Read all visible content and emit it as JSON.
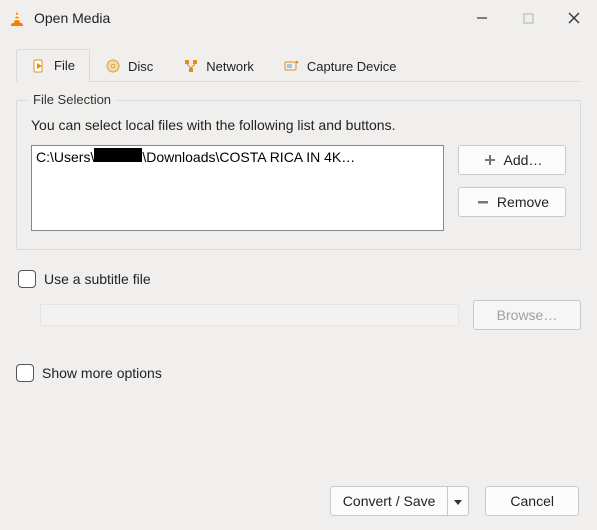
{
  "window": {
    "title": "Open Media"
  },
  "tabs": {
    "file": "File",
    "disc": "Disc",
    "network": "Network",
    "capture": "Capture Device"
  },
  "file_selection": {
    "group_title": "File Selection",
    "hint": "You can select local files with the following list and buttons.",
    "entry_prefix": "C:\\Users\\",
    "entry_suffix": "\\Downloads\\COSTA RICA IN 4K…",
    "add_label": "Add…",
    "remove_label": "Remove"
  },
  "subtitle": {
    "checkbox_label": "Use a subtitle file",
    "browse_label": "Browse…"
  },
  "more_options_label": "Show more options",
  "footer": {
    "convert_label": "Convert / Save",
    "cancel_label": "Cancel"
  }
}
